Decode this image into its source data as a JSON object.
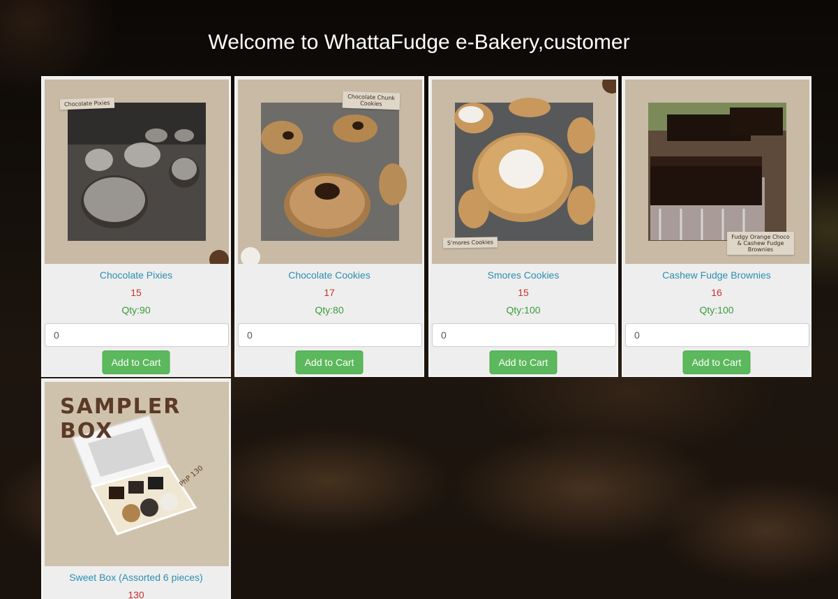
{
  "page": {
    "title": "Welcome to WhattaFudge e-Bakery,customer"
  },
  "products": [
    {
      "name": "Chocolate Pixies",
      "price": "15",
      "qty": "Qty:90",
      "input_value": "0",
      "button": "Add to Cart",
      "photo_label": "Chocolate Pixies"
    },
    {
      "name": "Chocolate Cookies",
      "price": "17",
      "qty": "Qty:80",
      "input_value": "0",
      "button": "Add to Cart",
      "photo_label": "Chocolate Chunk Cookies"
    },
    {
      "name": "Smores Cookies",
      "price": "15",
      "qty": "Qty:100",
      "input_value": "0",
      "button": "Add to Cart",
      "photo_label": "S'mores Cookies"
    },
    {
      "name": "Cashew Fudge Brownies",
      "price": "16",
      "qty": "Qty:100",
      "input_value": "0",
      "button": "Add to Cart",
      "photo_label": "Fudgy Orange Choco & Cashew Fudge Brownies"
    },
    {
      "name": "Sweet Box (Assorted 6 pieces)",
      "price": "130",
      "qty": "",
      "input_value": "",
      "button": "",
      "photo_label": "SAMPLER BOX",
      "photo_price": "PhP 130"
    }
  ],
  "colors": {
    "name_link": "#2a8fb0",
    "price": "#c9302c",
    "qty": "#3a9a3a",
    "button": "#5cb85c"
  }
}
